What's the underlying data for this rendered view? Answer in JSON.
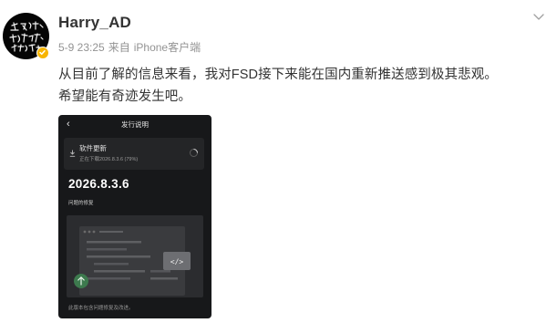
{
  "post": {
    "username": "Harry_AD",
    "time": "5-9 23:25",
    "source_prefix": "来自",
    "source": "iPhone客户端",
    "text_line1": "从目前了解的信息来看，我对FSD接下来能在国内重新推送感到极其悲观。",
    "text_line2": "希望能有奇迹发生吧。"
  },
  "icons": {
    "avatar": "avatar-calligraphy",
    "verified": "verified-badge-icon",
    "more": "chevron-down-icon"
  },
  "colors": {
    "username": "#333333",
    "meta": "#939393",
    "verified": "#f7b500",
    "screenshot_bg": "#17181a"
  },
  "screenshot": {
    "back_glyph": "‹",
    "title": "发行说明",
    "update_title": "软件更新",
    "update_status": "正在下载2026.8.3.6 (79%)",
    "version": "2026.8.3.6",
    "section_label": "问题的修复",
    "illustration_code_glyph": "</>",
    "footnote": "此版本包含问题修复及改进。"
  }
}
